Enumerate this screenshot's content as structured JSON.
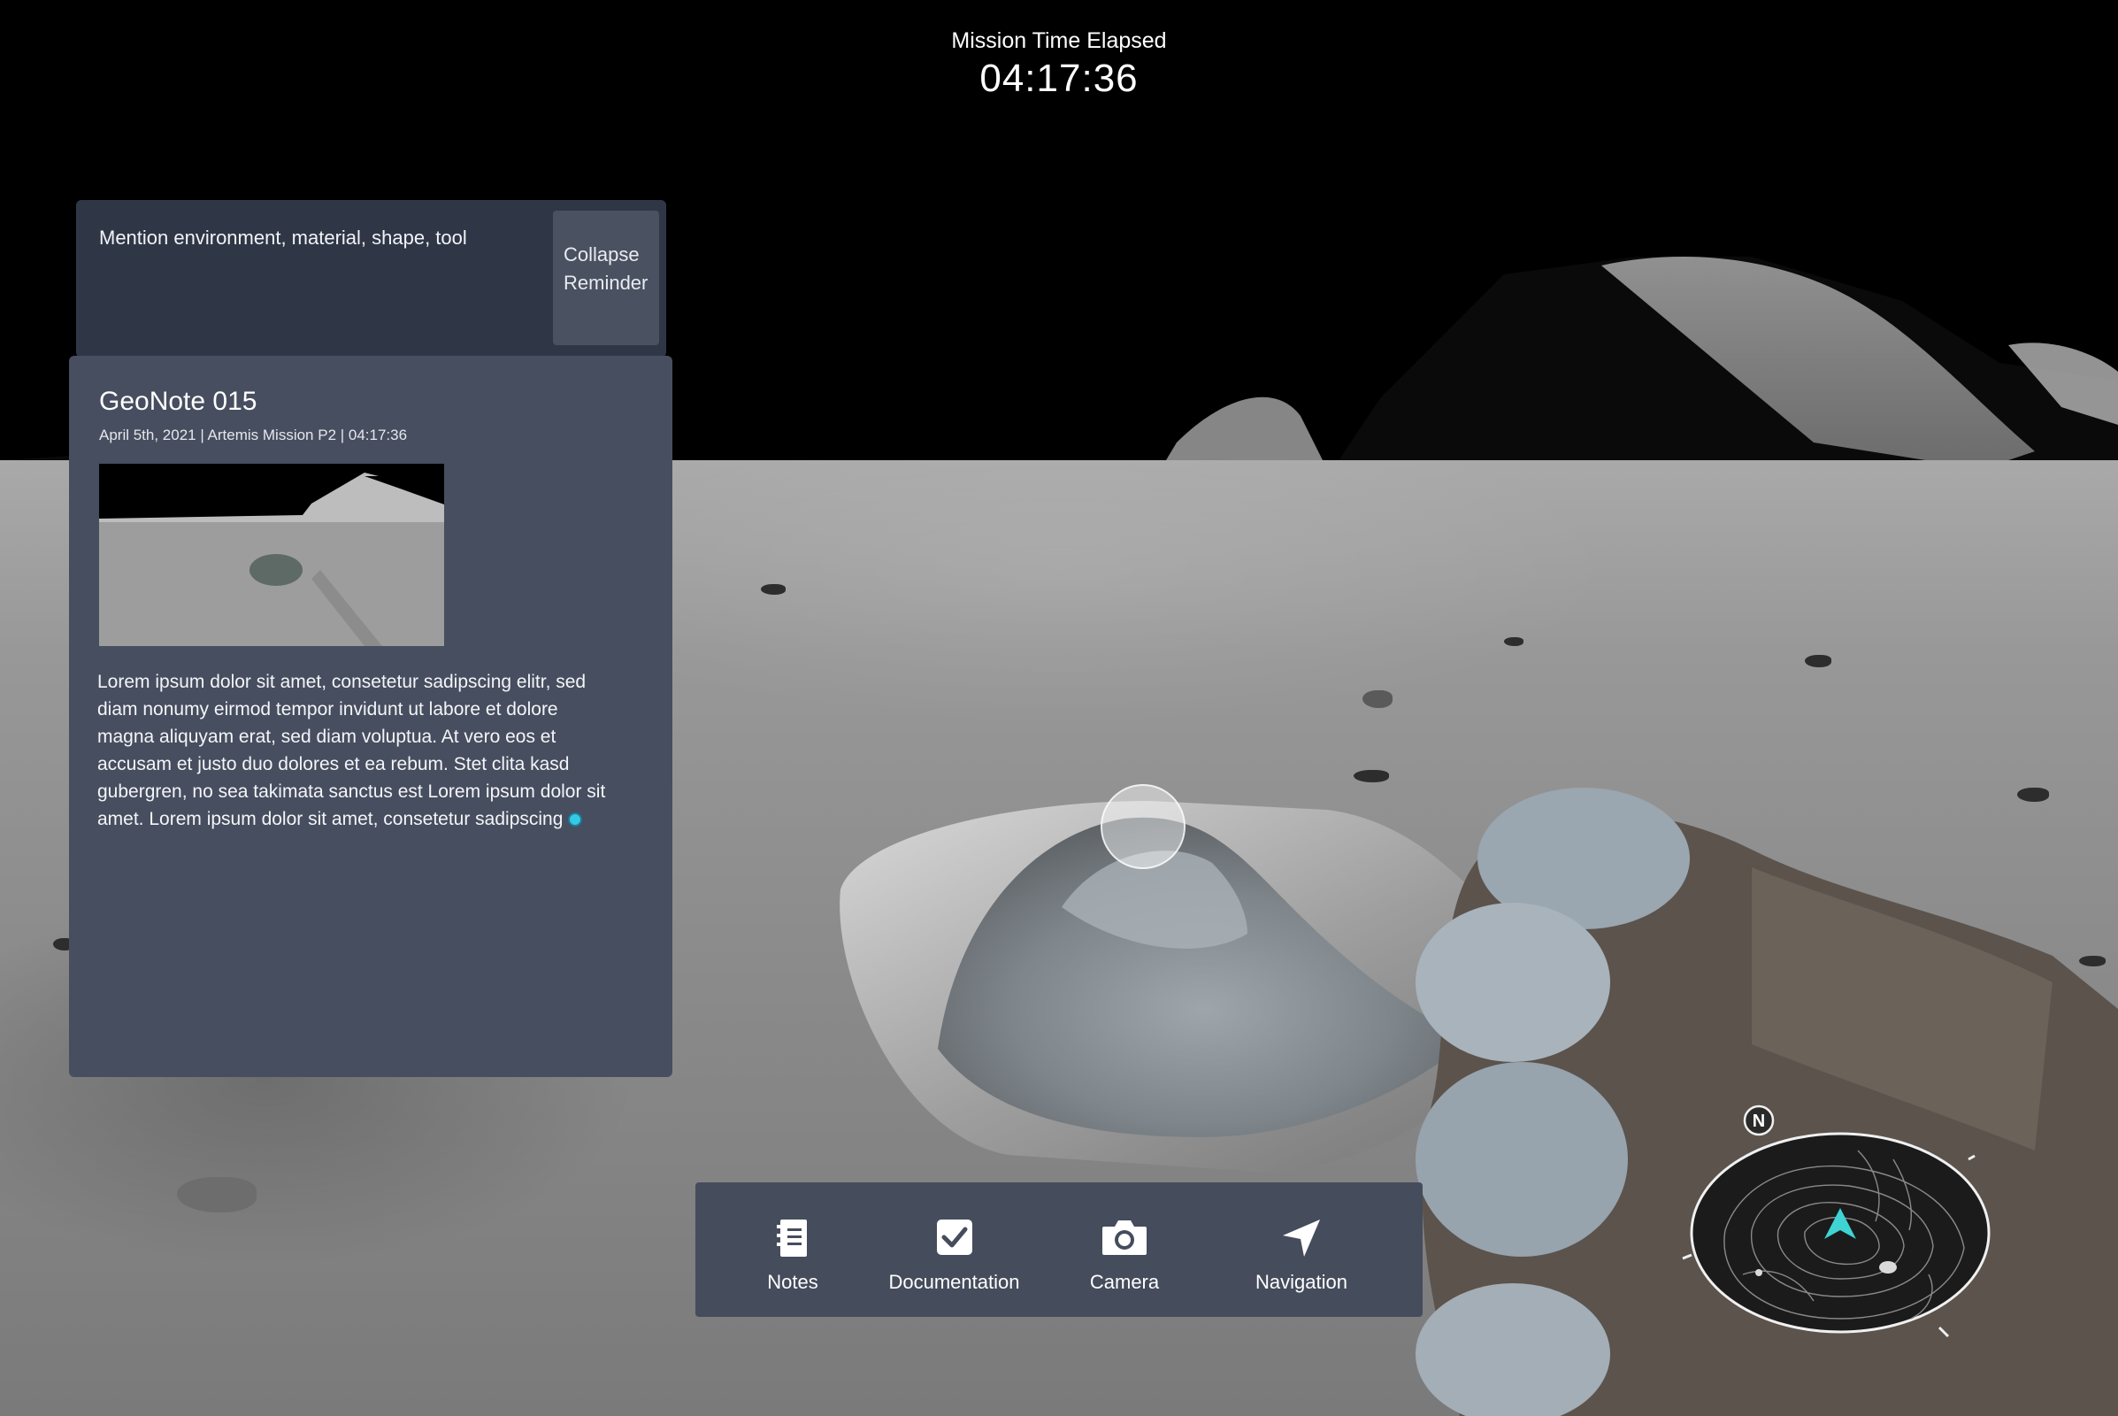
{
  "mission": {
    "label": "Mission Time Elapsed",
    "time": "04:17:36"
  },
  "reminder": {
    "text": "Mention environment, material, shape, tool",
    "collapse_label_line1": "Collapse",
    "collapse_label_line2": "Reminder"
  },
  "note": {
    "title": "GeoNote 015",
    "meta": "April 5th, 2021 | Artemis Mission P2 | 04:17:36",
    "body": "Lorem ipsum dolor sit amet, consetetur sadipscing elitr, sed diam nonumy eirmod tempor invidunt ut labore et dolore magna aliquyam erat, sed diam voluptua. At vero eos et accusam et justo duo dolores et ea rebum. Stet clita kasd gubergren, no sea takimata sanctus est Lorem ipsum dolor sit amet. Lorem ipsum dolor sit amet, consetetur sadipscing"
  },
  "toolbar": {
    "items": [
      {
        "label": "Notes",
        "icon": "notebook-icon"
      },
      {
        "label": "Documentation",
        "icon": "checkbox-icon"
      },
      {
        "label": "Camera",
        "icon": "camera-icon"
      },
      {
        "label": "Navigation",
        "icon": "navigation-arrow-icon"
      }
    ]
  },
  "compass": {
    "north_label": "N",
    "heading_color": "#3fd3d3"
  }
}
